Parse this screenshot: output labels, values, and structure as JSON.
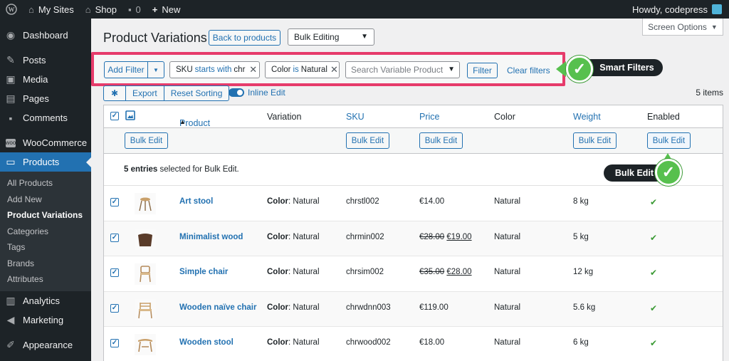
{
  "adminbar": {
    "my_sites": "My Sites",
    "shop": "Shop",
    "comments_count": "0",
    "new": "New",
    "howdy": "Howdy, codepress"
  },
  "sidebar": {
    "items": [
      {
        "label": "Dashboard",
        "icon": "dashboard-icon"
      },
      {
        "label": "Posts",
        "icon": "pin-icon"
      },
      {
        "label": "Media",
        "icon": "media-icon"
      },
      {
        "label": "Pages",
        "icon": "pages-icon"
      },
      {
        "label": "Comments",
        "icon": "comment-icon"
      },
      {
        "label": "WooCommerce",
        "icon": "woo-icon"
      },
      {
        "label": "Products",
        "icon": "archive-icon"
      }
    ],
    "submenu": [
      "All Products",
      "Add New",
      "Product Variations",
      "Categories",
      "Tags",
      "Brands",
      "Attributes"
    ],
    "lower": [
      {
        "label": "Analytics",
        "icon": "chart-icon"
      },
      {
        "label": "Marketing",
        "icon": "megaphone-icon"
      },
      {
        "label": "Appearance",
        "icon": "brush-icon"
      }
    ]
  },
  "page": {
    "title": "Product Variations",
    "back_label": "Back to products",
    "bulk_select": "Bulk Editing",
    "screen_options": "Screen Options"
  },
  "filters": {
    "add_filter": "Add Filter",
    "chip_sku": {
      "field": "SKU",
      "op": "starts with",
      "value": "chr"
    },
    "chip_color": {
      "field": "Color",
      "op": "is",
      "value": "Natural"
    },
    "search_placeholder": "Search Variable Product",
    "filter_button": "Filter",
    "clear": "Clear filters"
  },
  "callouts": {
    "smart": "Smart Filters",
    "bulk": "Bulk Edit"
  },
  "toolbar": {
    "export": "Export",
    "reset_sorting": "Reset Sorting",
    "inline_edit": "Inline Edit",
    "items_count": "5 items"
  },
  "table": {
    "headers": {
      "product": "Product",
      "variation": "Variation",
      "sku": "SKU",
      "price": "Price",
      "color": "Color",
      "weight": "Weight",
      "enabled": "Enabled"
    },
    "bulk_edit_label": "Bulk Edit",
    "notice_bold": "5 entries",
    "notice_rest": " selected for Bulk Edit.",
    "rows": [
      {
        "name": "Art stool",
        "var_key": "Color",
        "var_val": ": Natural",
        "sku": "chrstl002",
        "old_price": "",
        "price": "€14.00",
        "color": "Natural",
        "weight": "8 kg"
      },
      {
        "name": "Minimalist wood",
        "var_key": "Color",
        "var_val": ": Natural",
        "sku": "chrmin002",
        "old_price": "€28.00",
        "price": "€19.00",
        "color": "Natural",
        "weight": "5 kg"
      },
      {
        "name": "Simple chair",
        "var_key": "Color",
        "var_val": ": Natural",
        "sku": "chrsim002",
        "old_price": "€35.00",
        "price": "€28.00",
        "color": "Natural",
        "weight": "12 kg"
      },
      {
        "name": "Wooden naïve chair",
        "var_key": "Color",
        "var_val": ": Natural",
        "sku": "chrwdnn003",
        "old_price": "",
        "price": "€119.00",
        "color": "Natural",
        "weight": "5.6 kg"
      },
      {
        "name": "Wooden stool",
        "var_key": "Color",
        "var_val": ": Natural",
        "sku": "chrwood002",
        "old_price": "",
        "price": "€18.00",
        "color": "Natural",
        "weight": "6 kg"
      }
    ],
    "enabled_mark": "✔"
  },
  "colors": {
    "accent": "#2271b1",
    "sidebar": "#1d2327",
    "highlight": "#e63b6b",
    "success": "#57c04e"
  }
}
